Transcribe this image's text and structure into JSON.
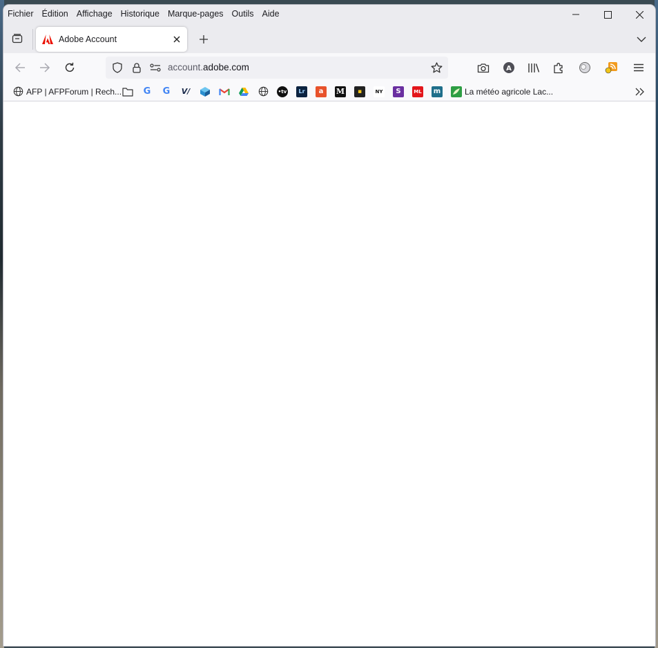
{
  "menubar": {
    "items": [
      {
        "label": "Fichier"
      },
      {
        "label": "Édition"
      },
      {
        "label": "Affichage"
      },
      {
        "label": "Historique"
      },
      {
        "label": "Marque-pages"
      },
      {
        "label": "Outils"
      },
      {
        "label": "Aide"
      }
    ]
  },
  "tab": {
    "title": "Adobe Account",
    "favicon": "adobe-logo-icon",
    "favicon_color": "#eb1000"
  },
  "urlbar": {
    "url_prefix": "account.",
    "url_domain": "adobe.com"
  },
  "bookmarks": {
    "items": [
      {
        "label": "AFP | AFPForum | Rech...",
        "icon": "globe-icon"
      },
      {
        "label": "",
        "icon": "folder-icon"
      },
      {
        "label": "",
        "icon": "google-icon"
      },
      {
        "label": "",
        "icon": "google-icon"
      },
      {
        "label": "",
        "icon": "vimeo-icon"
      },
      {
        "label": "",
        "icon": "cube-icon"
      },
      {
        "label": "",
        "icon": "gmail-icon"
      },
      {
        "label": "",
        "icon": "google-drive-icon"
      },
      {
        "label": "",
        "icon": "globe-icon"
      },
      {
        "label": "",
        "icon": "tv-icon",
        "text": "•tv"
      },
      {
        "label": "",
        "icon": "lightroom-icon",
        "text": "Lr"
      },
      {
        "label": "",
        "icon": "app-icon-orange",
        "text": "a"
      },
      {
        "label": "",
        "icon": "le-monde-icon",
        "text": "M"
      },
      {
        "label": "",
        "icon": "dark-app-icon",
        "text": "▪"
      },
      {
        "label": "",
        "icon": "news-icon",
        "text": "NY"
      },
      {
        "label": "",
        "icon": "purple-app-icon",
        "text": "S"
      },
      {
        "label": "",
        "icon": "ml-icon",
        "text": "ML"
      },
      {
        "label": "",
        "icon": "m-icon",
        "text": "m"
      },
      {
        "label": "La météo agricole Lac...",
        "icon": "meteo-icon"
      }
    ]
  },
  "colors": {
    "chrome_bg": "#ebebef",
    "toolbar_bg": "#f9f9fb",
    "urlbar_bg": "#f0f0f4"
  }
}
